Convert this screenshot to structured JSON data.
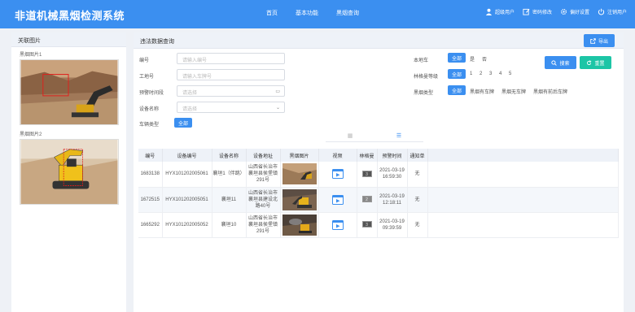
{
  "header": {
    "app_title": "非道机械黑烟检测系统",
    "nav": [
      "首页",
      "基本功能",
      "黑烟查询"
    ],
    "user_items": [
      {
        "label": "超级用户",
        "icon": "user-icon"
      },
      {
        "label": "密码修改",
        "icon": "edit-icon"
      },
      {
        "label": "偏好设置",
        "icon": "gear-icon"
      },
      {
        "label": "注销用户",
        "icon": "power-icon"
      }
    ]
  },
  "left_panel": {
    "title": "关联图片",
    "images": [
      {
        "label": "黑烟图片1",
        "alt": "excavator-smoke-scene"
      },
      {
        "label": "黑烟图片2",
        "alt": "yellow-excavator-scene"
      }
    ]
  },
  "main": {
    "title": "违法数据查询",
    "export_label": "导出",
    "form": {
      "serial_label": "编号",
      "serial_placeholder": "请输入编号",
      "site_label": "工地号",
      "site_placeholder": "请输入车牌号",
      "time_label": "预警时间段",
      "time_placeholder": "请选择",
      "device_label": "设备名称",
      "device_placeholder": "请选择",
      "vehicle_type_label": "车辆类型",
      "vehicle_type_chip": "全部",
      "local_label": "本地车",
      "local_options": [
        "全部",
        "是",
        "否"
      ],
      "ringelmann_label": "林格曼等级",
      "ringelmann_options": [
        "全部",
        "1",
        "2",
        "3",
        "4",
        "5"
      ],
      "smoke_type_label": "黑烟类型",
      "smoke_type_options": [
        "全部",
        "黑烟有车牌",
        "黑烟无车牌",
        "黑烟有前后车牌"
      ]
    },
    "search_label": "搜索",
    "reset_label": "重置",
    "view_tabs": [
      "▦",
      "☰"
    ],
    "table": {
      "headers": [
        "编号",
        "设备编号",
        "设备名称",
        "设备地址",
        "黑烟图片",
        "视频",
        "林格曼",
        "预警时间",
        "通知单"
      ],
      "rows": [
        {
          "id": "1683138",
          "device_no": "HYX101202005061",
          "device_name": "襄垣1（伴跳）",
          "address": "山西省长治市襄垣县侯堡镇291号",
          "ringelmann": "3",
          "time": "2021-03-19 16:59:30",
          "notice": "无"
        },
        {
          "id": "1672515",
          "device_no": "HYX101202005051",
          "device_name": "襄垣11",
          "address": "山西省长治市襄垣县建设北路40号",
          "ringelmann": "2",
          "time": "2021-03-19 12:18:11",
          "notice": "无"
        },
        {
          "id": "1665292",
          "device_no": "HYX101202005052",
          "device_name": "襄垣10",
          "address": "山西省长治市襄垣县侯堡镇291号",
          "ringelmann": "3",
          "time": "2021-03-19 09:39:59",
          "notice": "无"
        }
      ]
    }
  },
  "colors": {
    "primary": "#3b8ff0",
    "teal": "#1dc5a6",
    "panel_head": "#eef2f8"
  }
}
